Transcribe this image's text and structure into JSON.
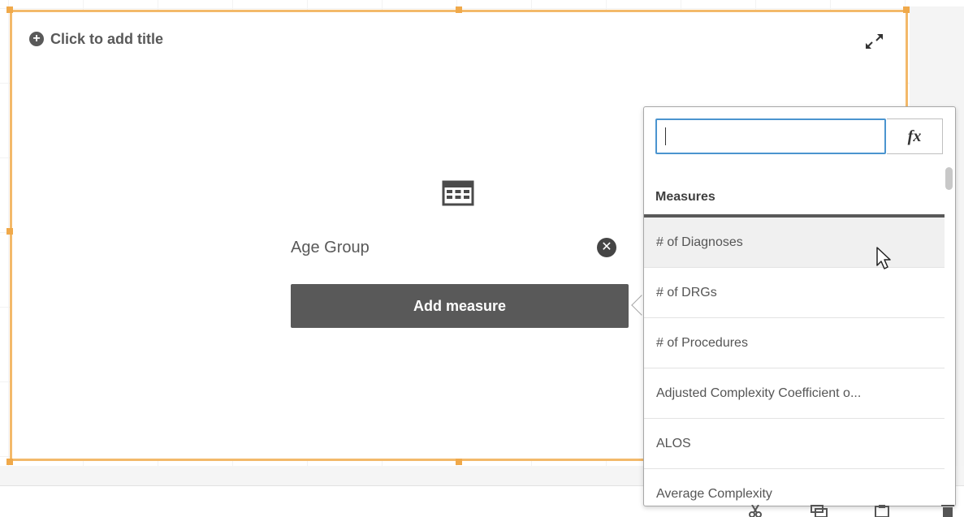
{
  "object": {
    "title_placeholder": "Click to add title",
    "dimension_label": "Age Group",
    "add_measure_label": "Add measure"
  },
  "popover": {
    "search_value": "",
    "fx_label": "fx",
    "section_title": "Measures",
    "items": [
      "# of Diagnoses",
      "# of DRGs",
      "# of Procedures",
      "Adjusted Complexity Coefficient o...",
      "ALOS",
      "Average Complexity"
    ]
  },
  "colors": {
    "selection": "#f3b96a",
    "button_bg": "#595959",
    "input_focus": "#4b94cf"
  },
  "icons": {
    "title_add": "plus-circle-icon",
    "expand": "expand-icon",
    "table": "table-icon",
    "remove": "close-circle-icon",
    "cursor": "mouse-pointer-icon"
  }
}
